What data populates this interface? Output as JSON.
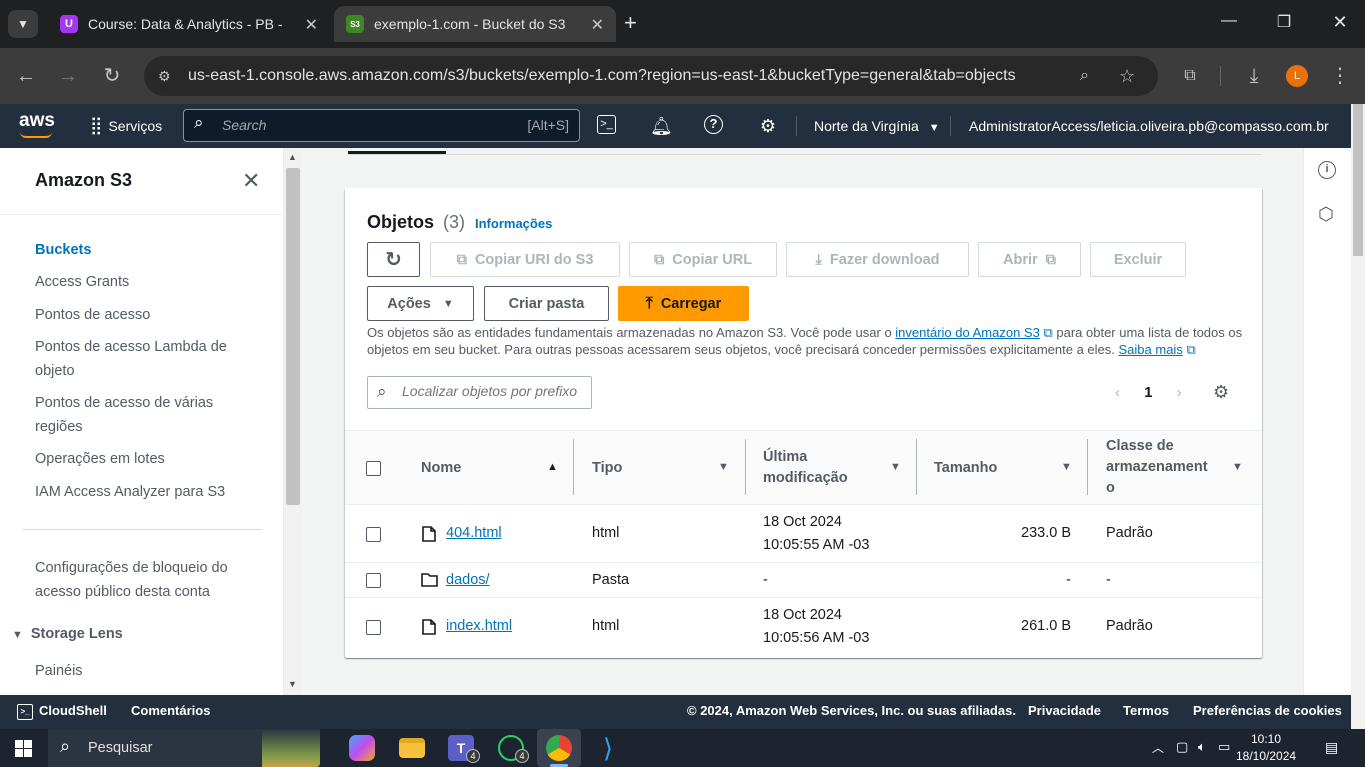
{
  "browser": {
    "tabs": [
      {
        "label": "Course: Data & Analytics - PB -",
        "favicon": "U"
      },
      {
        "label": "exemplo-1.com - Bucket do S3",
        "favicon": "S3"
      }
    ],
    "url": "us-east-1.console.aws.amazon.com/s3/buckets/exemplo-1.com?region=us-east-1&bucketType=general&tab=objects",
    "profile_initial": "L"
  },
  "aws_nav": {
    "logo": "aws",
    "services": "Serviços",
    "search_placeholder": "Search",
    "search_shortcut": "[Alt+S]",
    "region": "Norte da Virgínia",
    "account": "AdministratorAccess/leticia.oliveira.pb@compasso.com.br"
  },
  "sidebar": {
    "title": "Amazon S3",
    "items": [
      {
        "label": "Buckets",
        "active": true
      },
      {
        "label": "Access Grants"
      },
      {
        "label": "Pontos de acesso"
      },
      {
        "label": "Pontos de acesso Lambda de objeto"
      },
      {
        "label": "Pontos de acesso de várias regiões"
      },
      {
        "label": "Operações em lotes"
      },
      {
        "label": "IAM Access Analyzer para S3"
      }
    ],
    "block_public": "Configurações de bloqueio do acesso público desta conta",
    "storage_lens": "Storage Lens",
    "paineis": "Painéis"
  },
  "panel": {
    "title": "Objetos",
    "count": "(3)",
    "info": "Informações",
    "buttons": {
      "copy_uri": "Copiar URI do S3",
      "copy_url": "Copiar URL",
      "download": "Fazer download",
      "open": "Abrir",
      "delete": "Excluir",
      "actions": "Ações",
      "create_folder": "Criar pasta",
      "upload": "Carregar"
    },
    "desc_1": "Os objetos são as entidades fundamentais armazenadas no Amazon S3. Você pode usar o",
    "desc_link_1": "inventário do Amazon S3",
    "desc_2": "para obter uma lista de todos os objetos em seu bucket. Para outras pessoas acessarem seus objetos, você precisará conceder permissões explicitamente a eles.",
    "desc_link_2": "Saiba mais",
    "filter_placeholder": "Localizar objetos por prefixo",
    "page": "1"
  },
  "table": {
    "headers": {
      "name": "Nome",
      "type": "Tipo",
      "modified_1": "Última",
      "modified_2": "modificação",
      "size": "Tamanho",
      "class_1": "Classe de",
      "class_2": "armazenament",
      "class_3": "o"
    },
    "rows": [
      {
        "name": "404.html",
        "type": "html",
        "mod_1": "18 Oct 2024",
        "mod_2": "10:05:55 AM -03",
        "size": "233.0 B",
        "class": "Padrão",
        "kind": "file"
      },
      {
        "name": "dados/",
        "type": "Pasta",
        "mod_1": "-",
        "mod_2": "",
        "size": "-",
        "class": "-",
        "kind": "folder"
      },
      {
        "name": "index.html",
        "type": "html",
        "mod_1": "18 Oct 2024",
        "mod_2": "10:05:56 AM -03",
        "size": "261.0 B",
        "class": "Padrão",
        "kind": "file"
      }
    ]
  },
  "footer": {
    "cloudshell": "CloudShell",
    "comments": "Comentários",
    "copyright": "© 2024, Amazon Web Services, Inc. ou suas afiliadas.",
    "privacy": "Privacidade",
    "terms": "Termos",
    "cookies": "Preferências de cookies"
  },
  "taskbar": {
    "search": "Pesquisar",
    "time": "10:10",
    "date": "18/10/2024",
    "teams_badge": "4",
    "whatsapp_badge": "4"
  },
  "colors": {
    "aws_nav": "#232f3e",
    "accent_orange": "#ff9900",
    "link_blue": "#0073bb"
  }
}
